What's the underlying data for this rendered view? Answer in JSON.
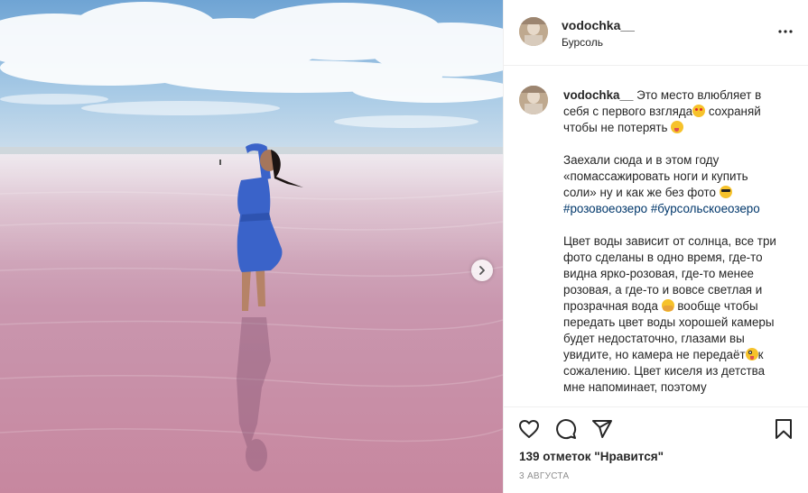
{
  "post": {
    "username": "vodochka__",
    "location": "Бурсоль",
    "caption": {
      "username": "vodochka__",
      "p1_a": "Это место влюбляет в себя с первого взгляда",
      "p1_b": " сохраняй чтобы не потерять ",
      "p2": "Заехали сюда и в этом году «помассажировать ноги и купить соли» ну и как же без фото ",
      "hashtag1": "#розовоеозеро",
      "hashtag2": "#бурсольскоеозеро",
      "p3_a": "Цвет воды зависит от солнца, все три фото сделаны в одно время, где-то видна ярко-розовая, где-то менее розовая, а где-то и вовсе светлая и прозрачная вода ",
      "p3_b": " вообще чтобы передать цвет воды хорошей камеры будет недостаточно, глазами вы увидите, но камера не передаёт",
      "p3_c": "к сожалению. Цвет киселя из детства мне напоминает, поэтому"
    },
    "likes_text": "139 отметок \"Нравится\"",
    "date": "3 августа"
  },
  "colors": {
    "text": "#262626",
    "hashtag": "#00376b",
    "secondary": "#8e8e8e",
    "border": "#efefef",
    "dress": "#3a63c9",
    "water": "#c28aa2"
  },
  "icons": [
    "heart-icon",
    "comment-icon",
    "share-icon",
    "bookmark-icon",
    "more-icon",
    "chevron-right-icon"
  ]
}
